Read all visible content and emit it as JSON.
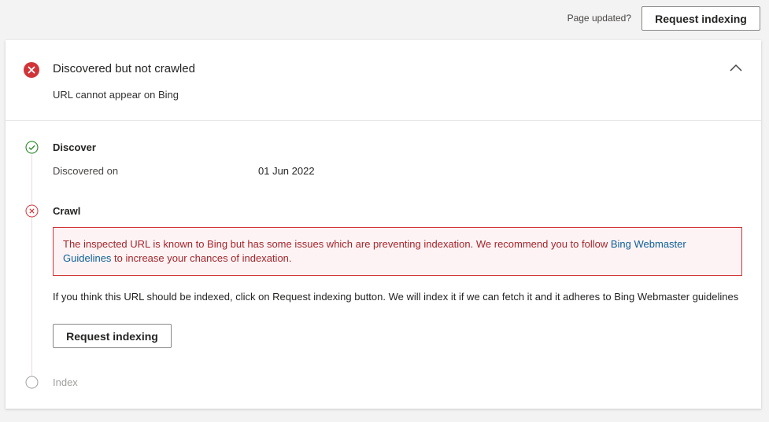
{
  "topbar": {
    "page_updated_text": "Page updated?",
    "request_indexing_label": "Request indexing"
  },
  "status": {
    "title": "Discovered but not crawled",
    "subtitle": "URL cannot appear on Bing",
    "icon": "error-circle-icon",
    "color": "#d13438"
  },
  "steps": {
    "discover": {
      "title": "Discover",
      "state": "success",
      "label": "Discovered on",
      "value": "01 Jun 2022"
    },
    "crawl": {
      "title": "Crawl",
      "state": "error",
      "error_text_before": "The inspected URL is known to Bing but has some issues which are preventing indexation. We recommend you to follow ",
      "error_link_text": "Bing Webmaster Guidelines",
      "error_text_after": " to increase your chances of indexation.",
      "info_text": "If you think this URL should be indexed, click on Request indexing button. We will index it if we can fetch it and it adheres to Bing Webmaster guidelines",
      "button_label": "Request indexing"
    },
    "index": {
      "title": "Index",
      "state": "pending"
    }
  },
  "colors": {
    "error": "#d13438",
    "success": "#107c10",
    "link": "#0e6198",
    "pending": "#a19f9d"
  }
}
